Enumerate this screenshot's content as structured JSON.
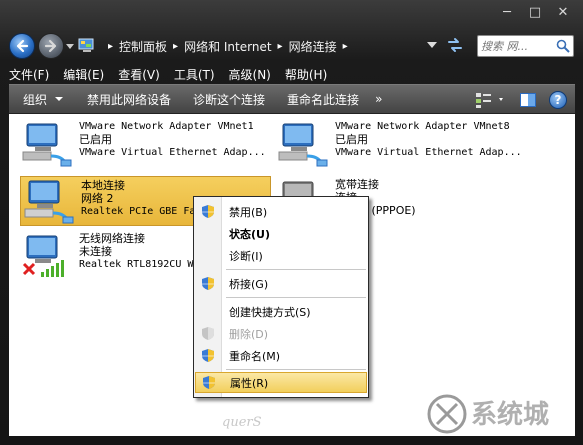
{
  "window": {
    "minimize": "─",
    "maximize": "□",
    "close": "✕"
  },
  "breadcrumb": {
    "items": [
      "控制面板",
      "网络和 Internet",
      "网络连接"
    ],
    "separator": "▸"
  },
  "search": {
    "placeholder": "搜索 网..."
  },
  "menubar": [
    "文件(F)",
    "编辑(E)",
    "查看(V)",
    "工具(T)",
    "高级(N)",
    "帮助(H)"
  ],
  "toolbar": {
    "organize": "组织",
    "disable_device": "禁用此网络设备",
    "diagnose": "诊断这个连接",
    "rename": "重命名此连接",
    "more": "»"
  },
  "adapters": [
    {
      "name": "VMware Network Adapter VMnet1",
      "status": "已启用",
      "device": "VMware Virtual Ethernet Adap..."
    },
    {
      "name": "VMware Network Adapter VMnet8",
      "status": "已启用",
      "device": "VMware Virtual Ethernet Adap..."
    },
    {
      "name": "本地连接",
      "status": "网络  2",
      "device": "Realtek PCIe GBE Fa"
    },
    {
      "name": "宽带连接",
      "status": "连接",
      "device": "型端口 (PPPOE)"
    },
    {
      "name": "无线网络连接",
      "status": "未连接",
      "device": "Realtek RTL8192CU W"
    }
  ],
  "context_menu": [
    {
      "label": "禁用(B)",
      "bold": false,
      "disabled": false,
      "shield": true
    },
    {
      "label": "状态(U)",
      "bold": true,
      "disabled": false,
      "shield": false
    },
    {
      "label": "诊断(I)",
      "bold": false,
      "disabled": false,
      "shield": false
    },
    {
      "label": "桥接(G)",
      "bold": false,
      "disabled": false,
      "shield": true
    },
    {
      "label": "创建快捷方式(S)",
      "bold": false,
      "disabled": false,
      "shield": false
    },
    {
      "label": "删除(D)",
      "bold": false,
      "disabled": true,
      "shield": true
    },
    {
      "label": "重命名(M)",
      "bold": false,
      "disabled": false,
      "shield": true
    },
    {
      "label": "属性(R)",
      "bold": false,
      "disabled": false,
      "shield": true,
      "hover": true
    }
  ],
  "colors": {
    "selection": "#f0c24a",
    "menu_hover": "#f5d46e",
    "toolbar": "#4d4d4d"
  },
  "watermark": {
    "brand": "系统城",
    "signature": "querS"
  }
}
